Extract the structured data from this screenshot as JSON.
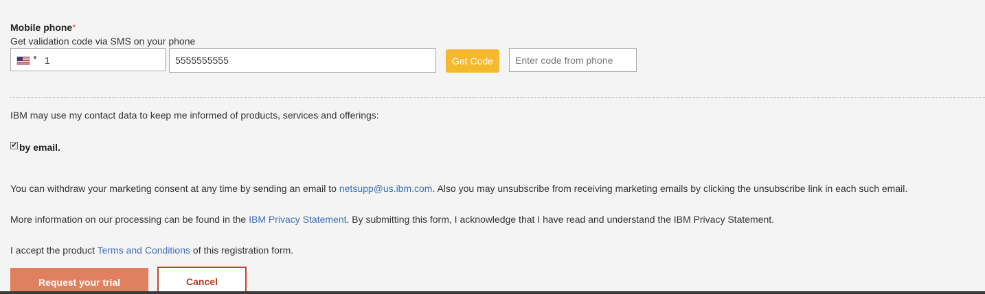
{
  "phone": {
    "label": "Mobile phone",
    "required_mark": "*",
    "help": "Get validation code via SMS on your phone",
    "country_icon": "us-flag-icon",
    "dial_code": "1",
    "number_value": "5555555555",
    "get_code_label": "Get Code",
    "code_placeholder": "Enter code from phone"
  },
  "consent": {
    "intro": "IBM may use my contact data to keep me informed of products, services and offerings:",
    "email_checked": true,
    "email_label": "by email.",
    "withdraw_before": "You can withdraw your marketing consent at any time by sending an email to ",
    "withdraw_link": "netsupp@us.ibm.com",
    "withdraw_after": ". Also you may unsubscribe from receiving marketing emails by clicking the unsubscribe link in each such email.",
    "privacy_before": "More information on our processing can be found in the ",
    "privacy_link": "IBM Privacy Statement",
    "privacy_after": ". By submitting this form, I acknowledge that I have read and understand the IBM Privacy Statement.",
    "terms_before": "I accept the product ",
    "terms_link": "Terms and Conditions",
    "terms_after": " of this registration form."
  },
  "actions": {
    "submit_label": "Request your trial",
    "cancel_label": "Cancel"
  },
  "colors": {
    "get_code": "#f5b82e",
    "primary_button": "#e0805e",
    "cancel_border": "#c0452a",
    "link": "#3d6fb6",
    "required": "#d9534f"
  }
}
